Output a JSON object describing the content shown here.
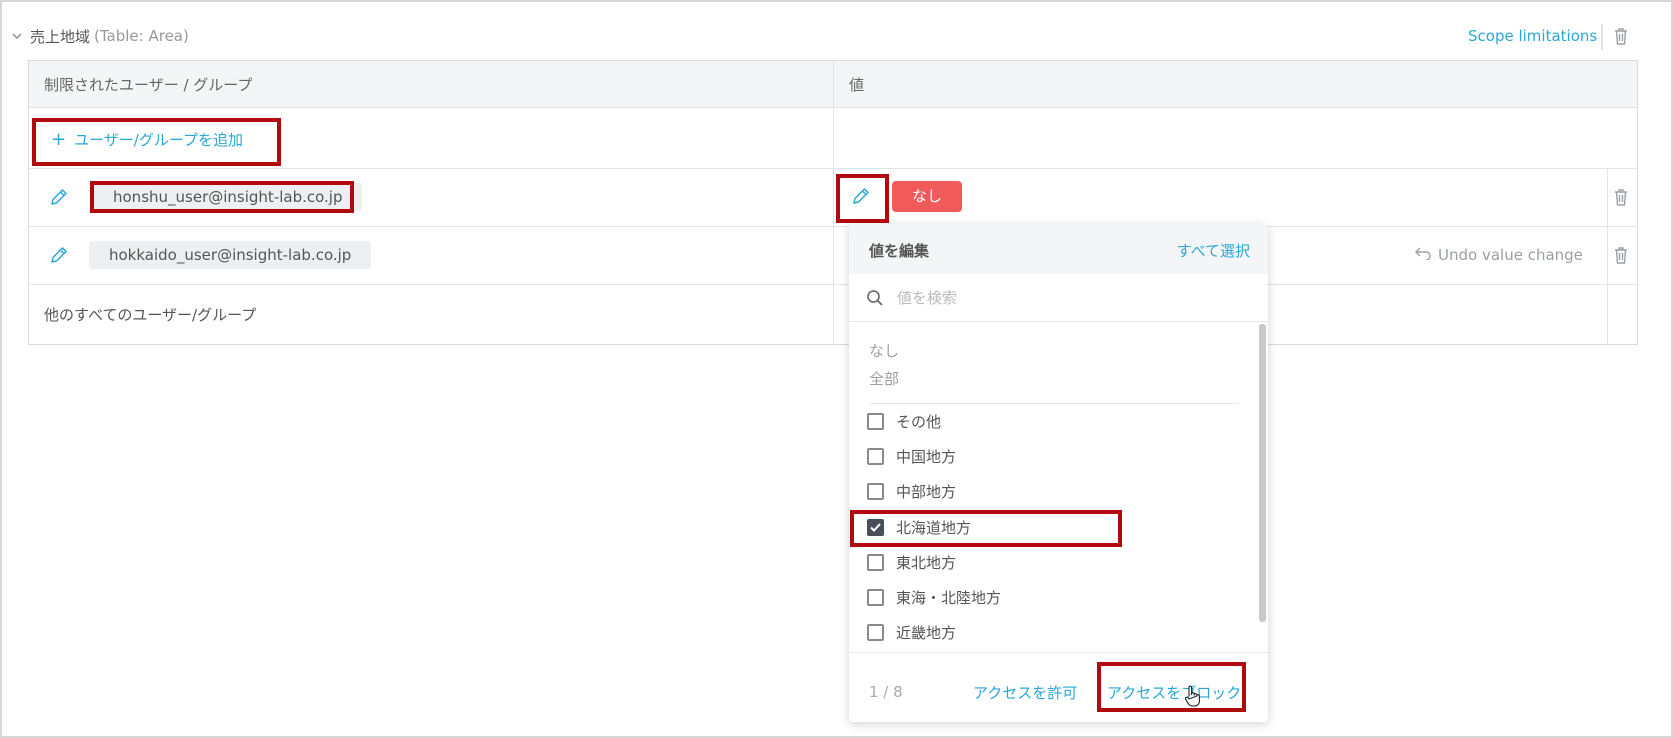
{
  "section": {
    "title": "売上地域",
    "table_note": "(Table: Area)",
    "scope_link": "Scope limitations"
  },
  "table": {
    "headers": [
      "制限されたユーザー / グループ",
      "値"
    ],
    "add_button": "ユーザー/グループを追加",
    "rows": [
      {
        "user": "honshu_user@insight-lab.co.jp",
        "value_badge": "なし"
      },
      {
        "user": "hokkaido_user@insight-lab.co.jp",
        "undo": "Undo value change"
      }
    ],
    "others_label": "他のすべてのユーザー/グループ"
  },
  "popup": {
    "title": "値を編集",
    "select_all": "すべて選択",
    "search_placeholder": "値を検索",
    "plain_options": [
      "なし",
      "全部"
    ],
    "options": [
      {
        "label": "その他",
        "checked": false
      },
      {
        "label": "中国地方",
        "checked": false
      },
      {
        "label": "中部地方",
        "checked": false
      },
      {
        "label": "北海道地方",
        "checked": true
      },
      {
        "label": "東北地方",
        "checked": false
      },
      {
        "label": "東海・北陸地方",
        "checked": false
      },
      {
        "label": "近畿地方",
        "checked": false
      }
    ],
    "count": "1 / 8",
    "allow_button": "アクセスを許可",
    "block_button": "アクセスをブロック"
  },
  "colors": {
    "accent": "#2aa7d8",
    "badge_red": "#f05a5b",
    "highlight": "#b0090e",
    "header_bg": "#f4f5f7"
  }
}
